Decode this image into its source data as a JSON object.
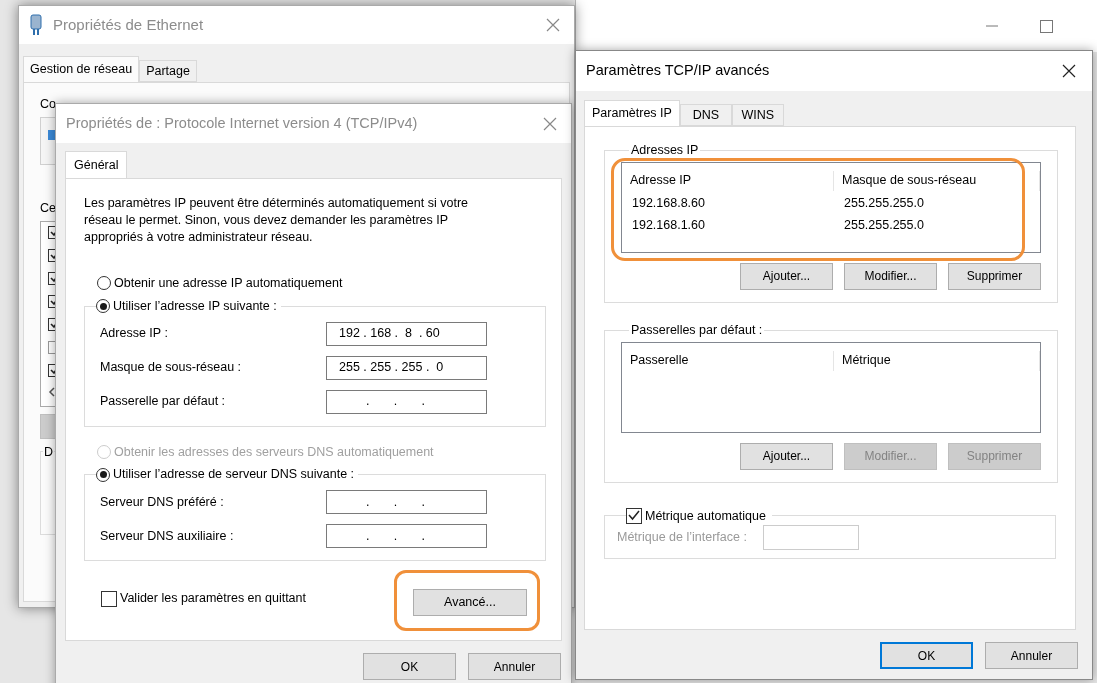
{
  "ethernet_window": {
    "title": "Propriétés de Ethernet",
    "tabs": [
      {
        "label": "Gestion de réseau",
        "selected": true
      },
      {
        "label": "Partage",
        "selected": false
      }
    ],
    "connection_label": "Co",
    "components_label": "Ce",
    "components": [
      {
        "checked": true
      },
      {
        "checked": true
      },
      {
        "checked": true
      },
      {
        "checked": true
      },
      {
        "checked": true
      },
      {
        "checked": false
      },
      {
        "checked": true
      }
    ],
    "description_label": "D"
  },
  "ipv4_dialog": {
    "title": "Propriétés de : Protocole Internet version 4 (TCP/IPv4)",
    "tabs": [
      {
        "label": "Général",
        "selected": true
      }
    ],
    "intro": "Les paramètres IP peuvent être déterminés automatiquement si votre réseau le permet. Sinon, vous devez demander les paramètres IP appropriés à votre administrateur réseau.",
    "ip_options": [
      {
        "label": "Obtenir une adresse IP automatiquement",
        "selected": false,
        "disabled": false
      },
      {
        "label": "Utiliser l’adresse IP suivante :",
        "selected": true,
        "disabled": false
      }
    ],
    "ip_fields": [
      {
        "label": "Adresse IP :",
        "value": "192 . 168 .  8  . 60"
      },
      {
        "label": "Masque de sous-réseau :",
        "value": "255 . 255 . 255 .  0"
      },
      {
        "label": "Passerelle par défaut :",
        "value": ".       .       ."
      }
    ],
    "dns_options": [
      {
        "label": "Obtenir les adresses des serveurs DNS automatiquement",
        "selected": false,
        "disabled": true
      },
      {
        "label": "Utiliser l’adresse de serveur DNS suivante :",
        "selected": true,
        "disabled": false
      }
    ],
    "dns_fields": [
      {
        "label": "Serveur DNS préféré :",
        "value": ".       .       ."
      },
      {
        "label": "Serveur DNS auxiliaire :",
        "value": ".       .       ."
      }
    ],
    "validate_on_exit": {
      "label": "Valider les paramètres en quittant",
      "checked": false
    },
    "advanced_button": {
      "label": "Avancé...",
      "highlighted": true
    },
    "buttons": [
      {
        "label": "OK"
      },
      {
        "label": "Annuler"
      }
    ]
  },
  "advanced_dialog": {
    "title": "Paramètres TCP/IP avancés",
    "tabs": [
      {
        "label": "Paramètres IP",
        "selected": true
      },
      {
        "label": "DNS",
        "selected": false
      },
      {
        "label": "WINS",
        "selected": false
      }
    ],
    "ip_addresses": {
      "title": "Adresses IP",
      "columns": [
        "Adresse IP",
        "Masque de sous-réseau"
      ],
      "rows": [
        [
          "192.168.8.60",
          "255.255.255.0"
        ],
        [
          "192.168.1.60",
          "255.255.255.0"
        ]
      ],
      "highlighted": true,
      "buttons": [
        {
          "label": "Ajouter...",
          "disabled": false
        },
        {
          "label": "Modifier...",
          "disabled": false
        },
        {
          "label": "Supprimer",
          "disabled": false
        }
      ]
    },
    "gateways": {
      "title": "Passerelles par défaut :",
      "columns": [
        "Passerelle",
        "Métrique"
      ],
      "buttons": [
        {
          "label": "Ajouter...",
          "disabled": false
        },
        {
          "label": "Modifier...",
          "disabled": true
        },
        {
          "label": "Supprimer",
          "disabled": true
        }
      ]
    },
    "automatic_metric": {
      "label": "Métrique automatique",
      "checked": true
    },
    "interface_metric": {
      "label": "Métrique de l’interface :",
      "disabled": true
    },
    "buttons": [
      {
        "label": "OK",
        "default": true
      },
      {
        "label": "Annuler",
        "default": false
      }
    ]
  }
}
